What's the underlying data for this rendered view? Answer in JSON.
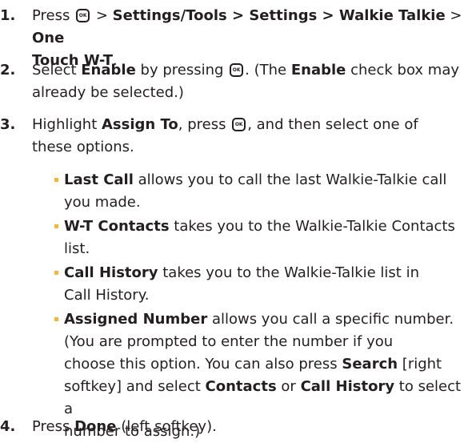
{
  "steps": [
    {
      "number": "1.",
      "parts": [
        "Press",
        ">",
        "Settings/Tools > Settings > Walkie Talkie",
        ">",
        "One",
        "Touch W-T",
        "."
      ]
    },
    {
      "number": "2.",
      "parts": [
        "Select",
        "Enable",
        "by pressing",
        ". (The",
        "Enable",
        "check box may",
        "already be selected.)"
      ]
    },
    {
      "number": "3.",
      "parts": [
        "Highlight",
        "Assign To",
        ", press",
        ", and then select one of",
        "these options."
      ]
    },
    {
      "number": "4.",
      "parts": [
        "Press",
        "Done",
        "(left softkey)."
      ]
    }
  ],
  "options": [
    {
      "name": "Last Call",
      "lines": [
        "allows you to call the last Walkie-Talkie call",
        "you made."
      ]
    },
    {
      "name": "W-T Contacts",
      "lines": [
        "takes you to the Walkie-Talkie Contacts",
        "list."
      ]
    },
    {
      "name": "Call History",
      "lines": [
        "takes you to the Walkie-Talkie list in",
        "Call History."
      ]
    },
    {
      "name": "Assigned Number",
      "lines": [
        "allows you call a specific number.",
        "(You are prompted to enter the number if you",
        "choose this option. You can also press",
        "Search",
        "[right",
        "softkey] and select",
        "Contacts",
        "or",
        "Call History",
        "to select a",
        "number to assign.)"
      ]
    }
  ],
  "icons": {
    "key": "menu-ok-key-icon"
  },
  "colors": {
    "text": "#231f20",
    "bullet": "#f2b73c"
  }
}
